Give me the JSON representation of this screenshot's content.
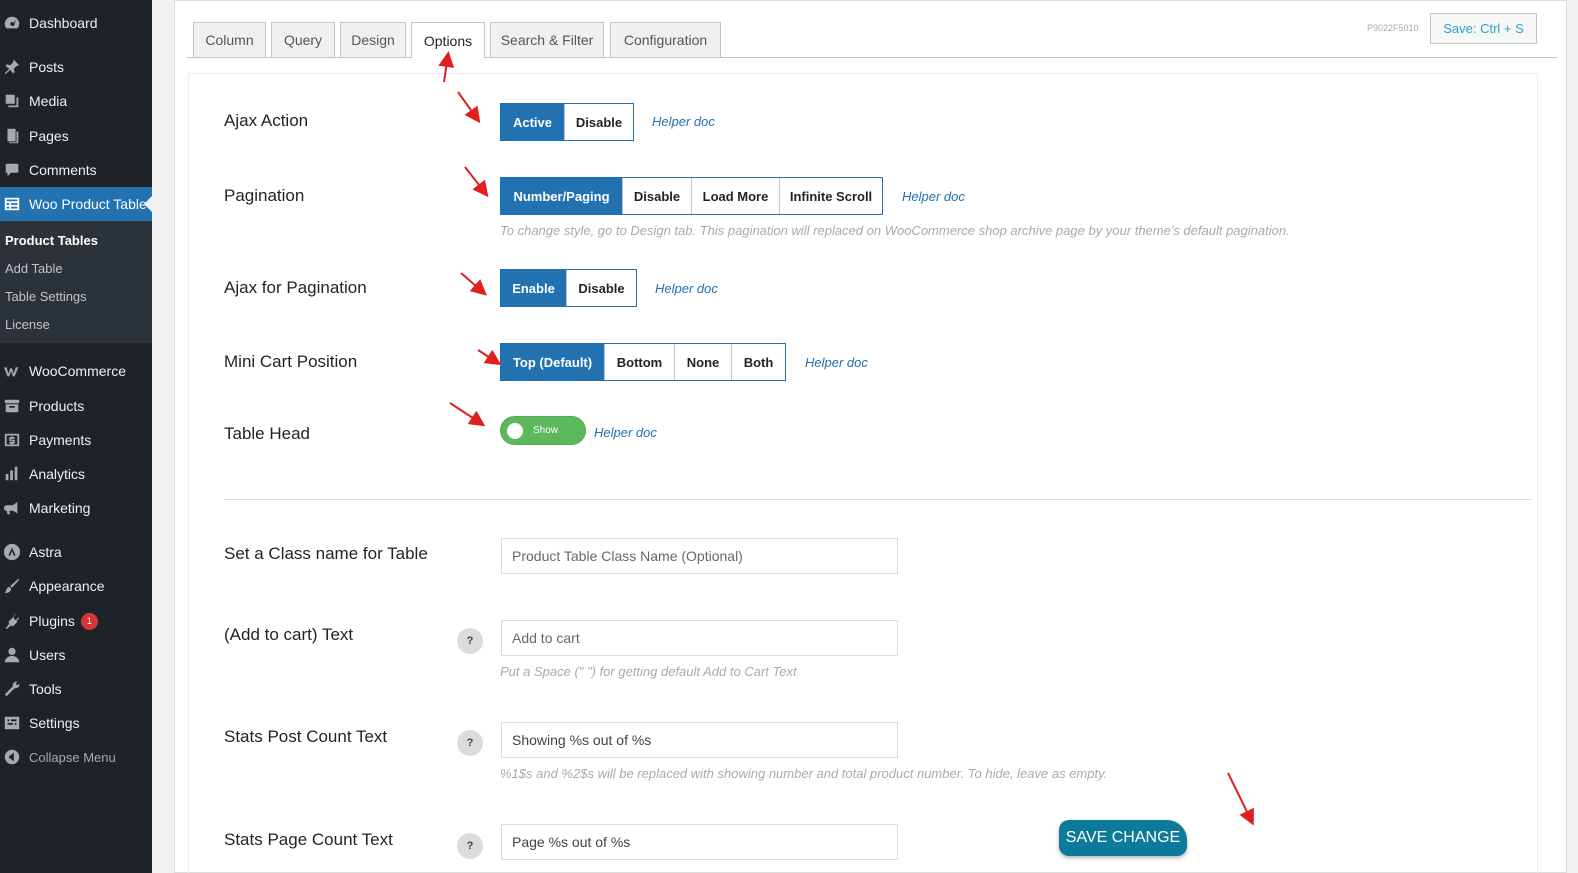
{
  "sidebar": {
    "items": [
      {
        "label": "Dashboard",
        "icon": "dashboard-icon"
      },
      {
        "label": "Posts",
        "icon": "pin-icon"
      },
      {
        "label": "Media",
        "icon": "media-icon"
      },
      {
        "label": "Pages",
        "icon": "pages-icon"
      },
      {
        "label": "Comments",
        "icon": "comment-icon"
      },
      {
        "label": "Woo Product Table",
        "icon": "table-icon"
      },
      {
        "label": "WooCommerce",
        "icon": "woo-icon"
      },
      {
        "label": "Products",
        "icon": "archive-icon"
      },
      {
        "label": "Payments",
        "icon": "dollar-icon"
      },
      {
        "label": "Analytics",
        "icon": "bar-chart-icon"
      },
      {
        "label": "Marketing",
        "icon": "megaphone-icon"
      },
      {
        "label": "Astra",
        "icon": "astra-icon"
      },
      {
        "label": "Appearance",
        "icon": "brush-icon"
      },
      {
        "label": "Plugins",
        "icon": "plug-icon",
        "badge": "1"
      },
      {
        "label": "Users",
        "icon": "user-icon"
      },
      {
        "label": "Tools",
        "icon": "wrench-icon"
      },
      {
        "label": "Settings",
        "icon": "settings-icon"
      },
      {
        "label": "Collapse Menu",
        "icon": "collapse-icon"
      }
    ],
    "submenu": [
      "Product Tables",
      "Add Table",
      "Table Settings",
      "License"
    ]
  },
  "tabs": [
    "Column",
    "Query",
    "Design",
    "Options",
    "Search & Filter",
    "Configuration"
  ],
  "code_tag": "P9022F5010",
  "save_shortcut": "Save: Ctrl + S",
  "helper_label": "Helper doc",
  "options": {
    "ajax_action": {
      "label": "Ajax Action",
      "buttons": [
        "Active",
        "Disable"
      ],
      "selected": "Active"
    },
    "pagination": {
      "label": "Pagination",
      "buttons": [
        "Number/Paging",
        "Disable",
        "Load More",
        "Infinite Scroll"
      ],
      "selected": "Number/Paging",
      "hint": "To change style, go to Design tab. This pagination will replaced on WooCommerce shop archive page by your theme's default pagination."
    },
    "ajax_pagination": {
      "label": "Ajax for Pagination",
      "buttons": [
        "Enable",
        "Disable"
      ],
      "selected": "Enable"
    },
    "mini_cart": {
      "label": "Mini Cart Position",
      "buttons": [
        "Top (Default)",
        "Bottom",
        "None",
        "Both"
      ],
      "selected": "Top (Default)"
    },
    "table_head": {
      "label": "Table Head",
      "toggle": "Show"
    }
  },
  "fields": {
    "class_name": {
      "label": "Set a Class name for Table",
      "placeholder": "Product Table Class Name (Optional)"
    },
    "add_to_cart": {
      "label": "(Add to cart) Text",
      "placeholder": "Add to cart",
      "hint": "Put a Space (\" \") for getting default Add to Cart Text"
    },
    "stats_post": {
      "label": "Stats Post Count Text",
      "value": "Showing %s out of %s",
      "hint": "%1$s and %2$s will be replaced with showing number and total product number. To hide, leave as empty."
    },
    "stats_page": {
      "label": "Stats Page Count Text",
      "value": "Page %s out of %s"
    }
  },
  "qmark": "?",
  "save_change": "SAVE CHANGE",
  "colors": {
    "sidebar": "#1d2327",
    "accent": "#2271b1",
    "toggle": "#5cb85c",
    "save": "#0c7a9b",
    "arrow": "#e02020"
  }
}
